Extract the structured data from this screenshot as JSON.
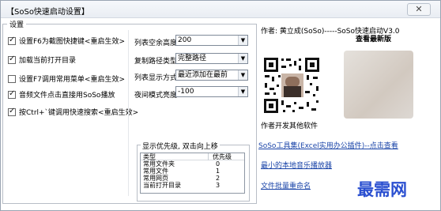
{
  "window": {
    "title": "【SoSo快速启动设置】",
    "close": "✕"
  },
  "settings": {
    "group_label": "设置",
    "options": [
      {
        "label": "设置F6为截图快捷键<重启生效>",
        "checked": true
      },
      {
        "label": "加载当前打开目录",
        "checked": true
      },
      {
        "label": "设置F7调用常用菜单<重启生效>",
        "checked": false
      },
      {
        "label": "音频文件点击直接用SoSo播放",
        "checked": true
      },
      {
        "label": "按Ctrl+`键调用快速搜索<重启生效>",
        "checked": true
      }
    ],
    "fields": [
      {
        "label": "列表空余高度",
        "value": "200"
      },
      {
        "label": "复制路径类型",
        "value": "完整路径"
      },
      {
        "label": "列表显示方式",
        "value": "最近添加在最前"
      },
      {
        "label": "夜间模式亮度",
        "value": "-100"
      }
    ]
  },
  "priority": {
    "group_label": "显示优先级, 双击向上移",
    "columns": [
      "类型",
      "优先级"
    ],
    "rows": [
      {
        "type": "常用文件夹",
        "priority": "0"
      },
      {
        "type": "常用文件",
        "priority": "1"
      },
      {
        "type": "常用网页",
        "priority": "2"
      },
      {
        "type": "当前打开目录",
        "priority": "3"
      }
    ]
  },
  "about": {
    "author": "作者: 黄立成(SoSo)-----SoSo快速启动V3.0",
    "check_latest": "查看最新版",
    "other_software": "作者开发其他软件",
    "links": [
      "SoSo工具集(Excel实用办公插件)--点击查看",
      "最小的本地音乐播放器",
      "文件批量重命名"
    ]
  },
  "watermark": "最需网"
}
